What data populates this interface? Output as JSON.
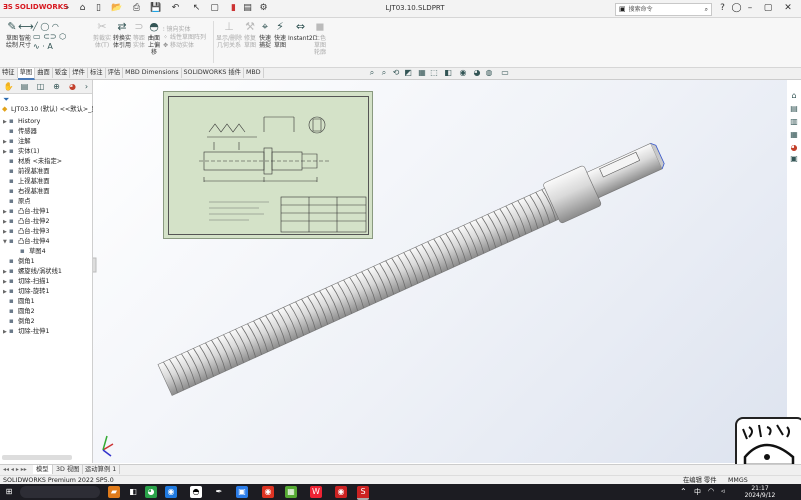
{
  "app": {
    "logo_text": "SOLIDWORKS",
    "logo_ds": "ƎS",
    "document_title": "LJT03.10.SLDPRT",
    "search_placeholder": "搜索命令",
    "accent_color": "#d71920"
  },
  "ribbon": {
    "big_buttons": [
      {
        "label": "草图\n绘制",
        "icon": "sketch-icon"
      },
      {
        "label": "智能\n尺寸",
        "icon": "smart-dimension-icon"
      },
      {
        "label": "剪裁实\n体(T)",
        "icon": "trim-icon"
      },
      {
        "label": "转换实\n体引用",
        "icon": "convert-icon"
      },
      {
        "label": "等距\n实体",
        "icon": "offset-icon"
      },
      {
        "label": "曲面\n上偏\n移",
        "icon": "surface-offset-icon"
      },
      {
        "label": "显示/删除\n几何关系",
        "icon": "relations-icon"
      },
      {
        "label": "修复\n草图",
        "icon": "repair-icon"
      },
      {
        "label": "快速\n捕捉",
        "icon": "snap-icon"
      },
      {
        "label": "快速\n草图",
        "icon": "rapid-sketch-icon"
      },
      {
        "label": "Instant2D",
        "icon": "instant2d-icon"
      },
      {
        "label": "上色\n草图\n轮廓",
        "icon": "shaded-sketch-icon"
      }
    ],
    "small_items": [
      "镜向实体",
      "线性草图阵列",
      "移动实体"
    ]
  },
  "command_tabs": [
    "特征",
    "草图",
    "曲面",
    "钣金",
    "焊件",
    "标注",
    "评估",
    "MBD Dimensions",
    "SOLIDWORKS 插件",
    "MBD"
  ],
  "active_command_tab": "草图",
  "tree": {
    "root": "LJT03.10 (默认) <<默认>_显示",
    "items": [
      {
        "label": "History",
        "icon": "history-icon",
        "level": 1,
        "expander": "▶"
      },
      {
        "label": "传感器",
        "icon": "sensor-icon",
        "level": 1,
        "expander": ""
      },
      {
        "label": "注解",
        "icon": "annotation-icon",
        "level": 1,
        "expander": "▶"
      },
      {
        "label": "实体(1)",
        "icon": "solid-bodies-icon",
        "level": 1,
        "expander": "▶"
      },
      {
        "label": "材质 <未指定>",
        "icon": "material-icon",
        "level": 1,
        "expander": ""
      },
      {
        "label": "前视基准面",
        "icon": "plane-icon",
        "level": 1,
        "expander": ""
      },
      {
        "label": "上视基准面",
        "icon": "plane-icon",
        "level": 1,
        "expander": ""
      },
      {
        "label": "右视基准面",
        "icon": "plane-icon",
        "level": 1,
        "expander": ""
      },
      {
        "label": "原点",
        "icon": "origin-icon",
        "level": 1,
        "expander": ""
      },
      {
        "label": "凸台-拉伸1",
        "icon": "extrude-icon",
        "level": 1,
        "expander": "▶"
      },
      {
        "label": "凸台-拉伸2",
        "icon": "extrude-icon",
        "level": 1,
        "expander": "▶"
      },
      {
        "label": "凸台-拉伸3",
        "icon": "extrude-icon",
        "level": 1,
        "expander": "▶"
      },
      {
        "label": "凸台-拉伸4",
        "icon": "extrude-icon",
        "level": 1,
        "expander": "▼"
      },
      {
        "label": "草图4",
        "icon": "sketch-icon",
        "level": 2,
        "expander": ""
      },
      {
        "label": "倒角1",
        "icon": "chamfer-icon",
        "level": 1,
        "expander": ""
      },
      {
        "label": "螺旋线/涡状线1",
        "icon": "helix-icon",
        "level": 1,
        "expander": "▶"
      },
      {
        "label": "切除-扫描1",
        "icon": "cut-sweep-icon",
        "level": 1,
        "expander": "▶"
      },
      {
        "label": "切除-旋转1",
        "icon": "cut-revolve-icon",
        "level": 1,
        "expander": "▶"
      },
      {
        "label": "圆角1",
        "icon": "fillet-icon",
        "level": 1,
        "expander": ""
      },
      {
        "label": "圆角2",
        "icon": "fillet-icon",
        "level": 1,
        "expander": ""
      },
      {
        "label": "倒角2",
        "icon": "chamfer-icon",
        "level": 1,
        "expander": ""
      },
      {
        "label": "切除-拉伸1",
        "icon": "cut-extrude-icon",
        "level": 1,
        "expander": "▶"
      }
    ]
  },
  "bottom_tabs": [
    "模型",
    "3D 视图",
    "运动算例 1"
  ],
  "active_bottom_tab": "模型",
  "status": {
    "left": "SOLIDWORKS Premium 2022 SP5.0",
    "mode": "在编辑 零件",
    "units": "MMGS"
  },
  "taskbar": {
    "time": "21:17",
    "date": "2024/9/12"
  }
}
